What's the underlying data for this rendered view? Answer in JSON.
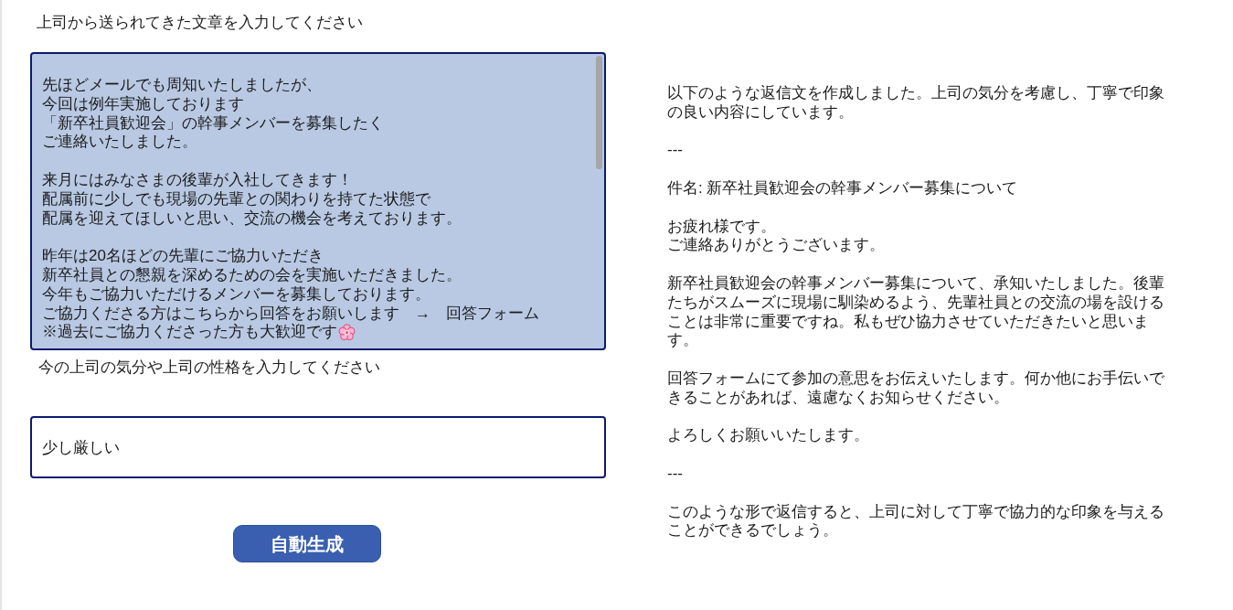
{
  "source_section": {
    "label": "上司から送られてきた文章を入力してください",
    "message_field": {
      "paragraphs": [
        [
          "先ほどメールでも周知いたしましたが、",
          "今回は例年実施しております",
          "「新卒社員歓迎会」の幹事メンバーを募集したく",
          "ご連絡いたしました。"
        ],
        [
          "来月にはみなさまの後輩が入社してきます！",
          "配属前に少しでも現場の先輩との関わりを持てた状態で",
          "配属を迎えてほしいと思い、交流の機会を考えております。"
        ],
        [
          "昨年は20名ほどの先輩にご協力いただき",
          "新卒社員との懇親を深めるための会を実施いただきました。",
          "今年もご協力いただけるメンバーを募集しております。",
          "ご協力くださる方はこちらから回答をお願いします　→　回答フォーム",
          "※過去にご協力くださった方も大歓迎です"
        ]
      ]
    }
  },
  "mood_section": {
    "label": "今の上司の気分や上司の性格を入力してください",
    "mood_field": {
      "value": "少し厳しい"
    }
  },
  "generate_button": {
    "label": "自動生成"
  },
  "reply": {
    "paragraphs": [
      [
        "以下のような返信文を作成しました。上司の気分を考慮し、丁寧で印象の良い内容にしています。"
      ],
      [
        "---"
      ],
      [
        "件名: 新卒社員歓迎会の幹事メンバー募集について"
      ],
      [
        "お疲れ様です。",
        "ご連絡ありがとうございます。"
      ],
      [
        "新卒社員歓迎会の幹事メンバー募集について、承知いたしました。後輩たちがスムーズに現場に馴染めるよう、先輩社員との交流の場を設けることは非常に重要ですね。私もぜひ協力させていただきたいと思います。"
      ],
      [
        "回答フォームにて参加の意思をお伝えいたします。何か他にお手伝いできることがあれば、遠慮なくお知らせください。"
      ],
      [
        "よろしくお願いいたします。"
      ],
      [
        "---"
      ],
      [
        "このような形で返信すると、上司に対して丁寧で協力的な印象を与えることができるでしょう。"
      ]
    ]
  }
}
